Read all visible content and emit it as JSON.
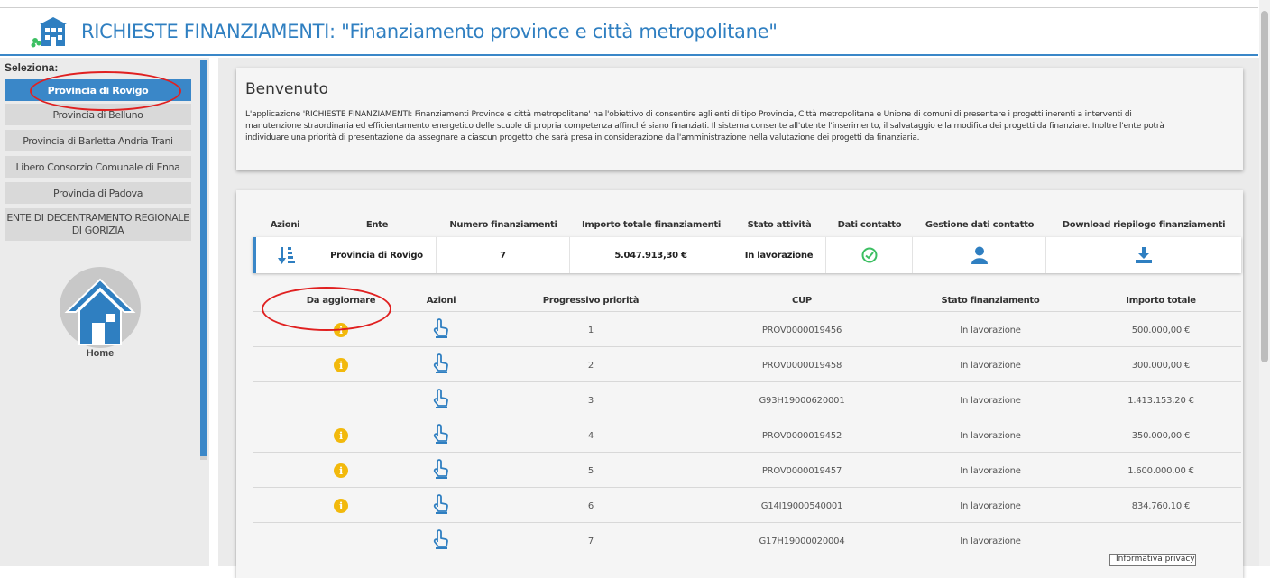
{
  "header": {
    "title": "RICHIESTE FINANZIAMENTI: \"Finanziamento province e città metropolitane\""
  },
  "sidebar": {
    "select_label": "Seleziona:",
    "items": [
      {
        "label": "Provincia di Rovigo",
        "active": true
      },
      {
        "label": "Provincia di Belluno"
      },
      {
        "label": "Provincia di Barletta Andria Trani"
      },
      {
        "label": "Libero Consorzio Comunale di Enna"
      },
      {
        "label": "Provincia di Padova"
      },
      {
        "label": "ENTE DI DECENTRAMENTO REGIONALE DI GORIZIA"
      }
    ],
    "home_label": "Home"
  },
  "welcome": {
    "title": "Benvenuto",
    "text": "L'applicazione 'RICHIESTE FINANZIAMENTI: Finanziamenti Province e città metropolitane' ha l'obiettivo di consentire agli enti di tipo Provincia, Città metropolitana e Unione di comuni di presentare i progetti inerenti a interventi di manutenzione straordinaria ed efficientamento energetico delle scuole di propria competenza affinché siano finanziati. Il sistema consente all'utente l'inserimento, il salvataggio e la modifica dei progetti da finanziare. Inoltre l'ente potrà individuare una priorità di presentazione da assegnare a ciascun progetto che sarà presa in considerazione dall'amministrazione nella valutazione dei progetti da finanziaria."
  },
  "summary_table": {
    "headers": [
      "Azioni",
      "Ente",
      "Numero finanziamenti",
      "Importo totale finanziamenti",
      "Stato attività",
      "Dati contatto",
      "Gestione dati contatto",
      "Download riepilogo finanziamenti"
    ],
    "row": {
      "ente": "Provincia di Rovigo",
      "numero": "7",
      "importo": "5.047.913,30 €",
      "stato": "In lavorazione"
    }
  },
  "detail_table": {
    "headers": [
      "Da aggiornare",
      "Azioni",
      "Progressivo priorità",
      "CUP",
      "Stato finanziamento",
      "Importo totale"
    ],
    "rows": [
      {
        "da_aggiornare": true,
        "priorita": "1",
        "cup": "PROV0000019456",
        "stato": "In lavorazione",
        "importo": "500.000,00 €"
      },
      {
        "da_aggiornare": true,
        "priorita": "2",
        "cup": "PROV0000019458",
        "stato": "In lavorazione",
        "importo": "300.000,00 €"
      },
      {
        "da_aggiornare": false,
        "priorita": "3",
        "cup": "G93H19000620001",
        "stato": "In lavorazione",
        "importo": "1.413.153,20 €"
      },
      {
        "da_aggiornare": true,
        "priorita": "4",
        "cup": "PROV0000019452",
        "stato": "In lavorazione",
        "importo": "350.000,00 €"
      },
      {
        "da_aggiornare": true,
        "priorita": "5",
        "cup": "PROV0000019457",
        "stato": "In lavorazione",
        "importo": "1.600.000,00 €"
      },
      {
        "da_aggiornare": true,
        "priorita": "6",
        "cup": "G14I19000540001",
        "stato": "In lavorazione",
        "importo": "834.760,10 €"
      },
      {
        "da_aggiornare": false,
        "priorita": "7",
        "cup": "G17H19000020004",
        "stato": "In lavorazione",
        "importo": ""
      }
    ]
  },
  "privacy_label": "Informativa privacy",
  "colors": {
    "accent": "#3a87c8",
    "warning": "#f2b90c",
    "ok": "#3cbf62",
    "annotation": "#e02020"
  }
}
